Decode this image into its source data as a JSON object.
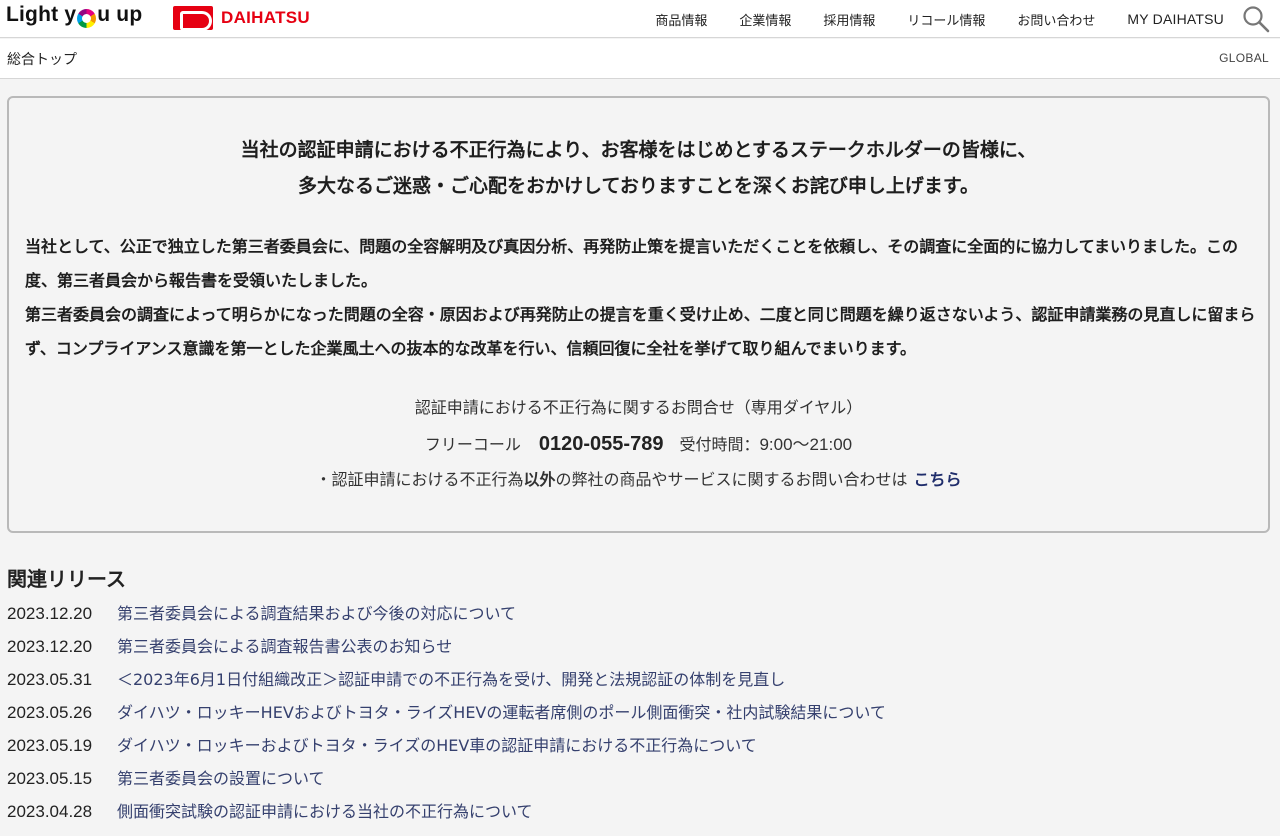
{
  "header": {
    "brand_light": "Light y",
    "brand_rest": "u up",
    "maker_name": "DAIHATSU",
    "nav": [
      {
        "label": "商品情報"
      },
      {
        "label": "企業情報"
      },
      {
        "label": "採用情報"
      },
      {
        "label": "リコール情報"
      },
      {
        "label": "お問い合わせ"
      },
      {
        "label": "MY DAIHATSU"
      }
    ],
    "search_icon": "search-icon"
  },
  "breadcrumb": {
    "label": "総合トップ",
    "global_label": "GLOBAL"
  },
  "notice": {
    "headline_line1": "当社の認証申請における不正行為により、お客様をはじめとするステークホルダーの皆様に、",
    "headline_line2": "多大なるご迷惑・ご心配をおかけしておりますことを深くお詫び申し上げます。",
    "para1": "当社として、公正で独立した第三者委員会に、問題の全容解明及び真因分析、再発防止策を提言いただくことを依頼し、その調査に全面的に協力してまいりました。この度、第三者員会から報告書を受領いたしました。",
    "para2": "第三者委員会の調査によって明らかになった問題の全容・原因および再発防止の提言を重く受け止め、二度と同じ問題を繰り返さないよう、認証申請業務の見直しに留まらず、コンプライアンス意識を第一とした企業風土への抜本的な改革を行い、信頼回復に全社を挙げて取り組んでまいります。",
    "contact_title": "認証申請における不正行為に関するお問合せ（専用ダイヤル）",
    "free_call_label": "フリーコール",
    "phone": "0120-055-789",
    "hours_label": "受付時間：",
    "hours_time": "9:00〜21:00",
    "other_prefix": "・認証申請における不正行為",
    "other_strong": "以外",
    "other_suffix": "の弊社の商品やサービスに関するお問い合わせは",
    "other_link": "こちら"
  },
  "related": {
    "title": "関連リリース",
    "items": [
      {
        "date": "2023.12.20",
        "title": "第三者委員会による調査結果および今後の対応について"
      },
      {
        "date": "2023.12.20",
        "title": "第三者委員会による調査報告書公表のお知らせ"
      },
      {
        "date": "2023.05.31",
        "title": "＜2023年6月1日付組織改正＞認証申請での不正行為を受け、開発と法規認証の体制を見直し"
      },
      {
        "date": "2023.05.26",
        "title": "ダイハツ・ロッキーHEVおよびトヨタ・ライズHEVの運転者席側のポール側面衝突・社内試験結果について"
      },
      {
        "date": "2023.05.19",
        "title": "ダイハツ・ロッキーおよびトヨタ・ライズのHEV車の認証申請における不正行為について"
      },
      {
        "date": "2023.05.15",
        "title": "第三者委員会の設置について"
      },
      {
        "date": "2023.04.28",
        "title": "側面衝突試験の認証申請における当社の不正行為について"
      }
    ]
  }
}
